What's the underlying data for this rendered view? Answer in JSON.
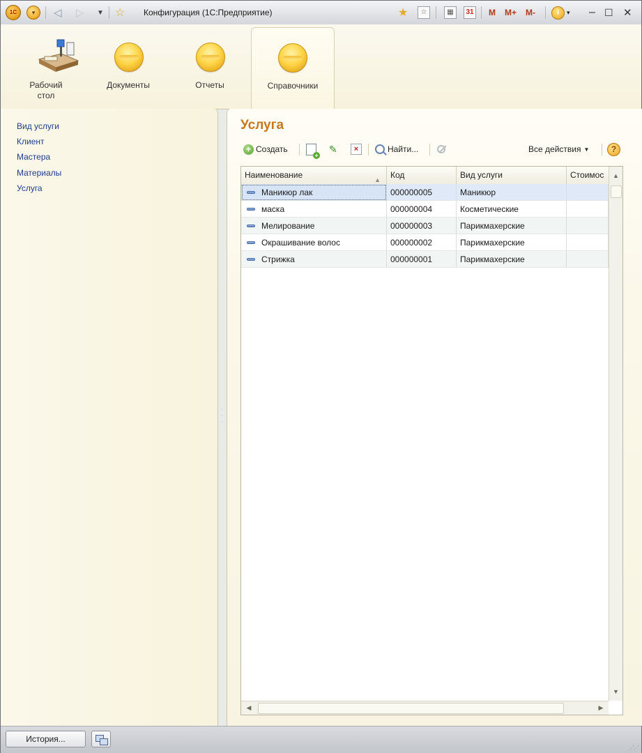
{
  "titlebar": {
    "title": "Конфигурация  (1С:Предприятие)",
    "logo_text": "1С",
    "m_label": "M",
    "mplus_label": "M+",
    "mminus_label": "M-",
    "calendar_text": "31"
  },
  "sections": [
    {
      "label": "Рабочий\nстол",
      "icon": "desktop-icon",
      "active": false
    },
    {
      "label": "Документы",
      "icon": "section-circle-icon",
      "active": false
    },
    {
      "label": "Отчеты",
      "icon": "section-circle-icon",
      "active": false
    },
    {
      "label": "Справочники",
      "icon": "section-circle-icon",
      "active": true
    }
  ],
  "sidebar": {
    "items": [
      {
        "label": "Вид услуги"
      },
      {
        "label": "Клиент"
      },
      {
        "label": "Мастера"
      },
      {
        "label": "Материалы"
      },
      {
        "label": "Услуга"
      }
    ]
  },
  "form": {
    "title": "Услуга",
    "toolbar": {
      "create_label": "Создать",
      "find_label": "Найти...",
      "all_actions_label": "Все действия",
      "help_label": "?"
    },
    "table": {
      "columns": [
        "Наименование",
        "Код",
        "Вид услуги",
        "Стоимос"
      ],
      "rows": [
        {
          "name": "Маникюр лак",
          "code": "000000005",
          "kind": "Маникюр",
          "cost": "",
          "selected": true
        },
        {
          "name": "маска",
          "code": "000000004",
          "kind": "Косметические",
          "cost": "",
          "selected": false
        },
        {
          "name": "Мелирование",
          "code": "000000003",
          "kind": "Парикмахерские",
          "cost": "",
          "selected": false
        },
        {
          "name": "Окрашивание волос",
          "code": "000000002",
          "kind": "Парикмахерские",
          "cost": "",
          "selected": false
        },
        {
          "name": "Стрижка",
          "code": "000000001",
          "kind": "Парикмахерские",
          "cost": "",
          "selected": false
        }
      ]
    }
  },
  "statusbar": {
    "history_label": "История..."
  },
  "colors": {
    "form_title": "#c8781b",
    "link": "#1c3e8d",
    "selected_row": "#dfe9f7"
  }
}
